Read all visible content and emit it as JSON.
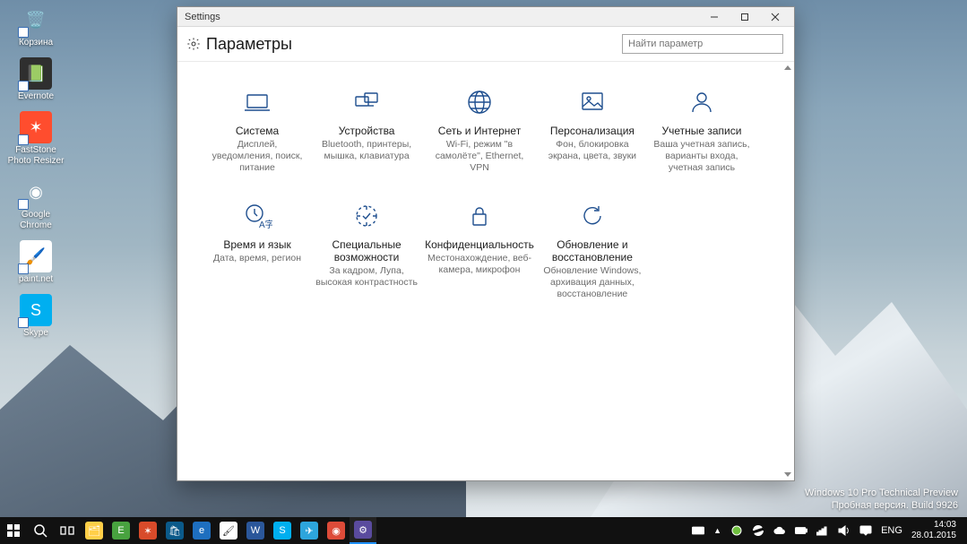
{
  "desktop": {
    "icons": [
      {
        "label": "Корзина",
        "emoji": "🗑️",
        "bg": "transparent"
      },
      {
        "label": "Evernote",
        "emoji": "📗",
        "bg": "#2f2f2f"
      },
      {
        "label": "FastStone Photo Resizer",
        "emoji": "✶",
        "bg": "#ff4d2e"
      },
      {
        "label": "Google Chrome",
        "emoji": "◉",
        "bg": "transparent"
      },
      {
        "label": "paint.net",
        "emoji": "🖌️",
        "bg": "#ffffff"
      },
      {
        "label": "Skype",
        "emoji": "S",
        "bg": "#00aff0"
      }
    ]
  },
  "window": {
    "title": "Settings",
    "header": "Параметры",
    "searchPlaceholder": "Найти параметр"
  },
  "categories": [
    {
      "title": "Система",
      "desc": "Дисплей, уведомления, поиск, питание",
      "icon": "system"
    },
    {
      "title": "Устройства",
      "desc": "Bluetooth, принтеры, мышка, клавиатура",
      "icon": "devices"
    },
    {
      "title": "Сеть и Интернет",
      "desc": "Wi-Fi, режим \"в самолёте\", Ethernet, VPN",
      "icon": "network"
    },
    {
      "title": "Персонализация",
      "desc": "Фон, блокировка экрана, цвета, звуки",
      "icon": "personalization"
    },
    {
      "title": "Учетные записи",
      "desc": "Ваша учетная запись, варианты входа, учетная запись",
      "icon": "accounts"
    },
    {
      "title": "Время и язык",
      "desc": "Дата, время, регион",
      "icon": "time"
    },
    {
      "title": "Специальные возможности",
      "desc": "За кадром, Лупа, высокая контрастность",
      "icon": "ease"
    },
    {
      "title": "Конфиденциальность",
      "desc": "Местонахождение, веб-камера, микрофон",
      "icon": "privacy"
    },
    {
      "title": "Обновление и восстановление",
      "desc": "Обновление Windows, архивация данных, восстановление",
      "icon": "update"
    }
  ],
  "watermark": {
    "line1": "Windows 10 Pro Technical Preview",
    "line2": "Пробная версия. Build 9926"
  },
  "taskbar": {
    "apps": [
      {
        "name": "file-explorer",
        "bg": "#ffcf48",
        "glyph": "🗂"
      },
      {
        "name": "evernote",
        "bg": "#48a23f",
        "glyph": "E"
      },
      {
        "name": "faststone",
        "bg": "#d84b2a",
        "glyph": "✶"
      },
      {
        "name": "store",
        "bg": "#0b5a8a",
        "glyph": "🛍"
      },
      {
        "name": "ie",
        "bg": "#1e6fbf",
        "glyph": "e"
      },
      {
        "name": "paintnet",
        "bg": "#ffffff",
        "glyph": "🖌"
      },
      {
        "name": "word",
        "bg": "#2b579a",
        "glyph": "W"
      },
      {
        "name": "skype",
        "bg": "#00aff0",
        "glyph": "S"
      },
      {
        "name": "telegram",
        "bg": "#2da5dc",
        "glyph": "✈"
      },
      {
        "name": "chrome",
        "bg": "#dd4b39",
        "glyph": "◉"
      },
      {
        "name": "settings",
        "bg": "#5a4b9e",
        "glyph": "⚙",
        "active": true
      }
    ],
    "lang": "ENG",
    "time": "14:03",
    "date": "28.01.2015"
  }
}
